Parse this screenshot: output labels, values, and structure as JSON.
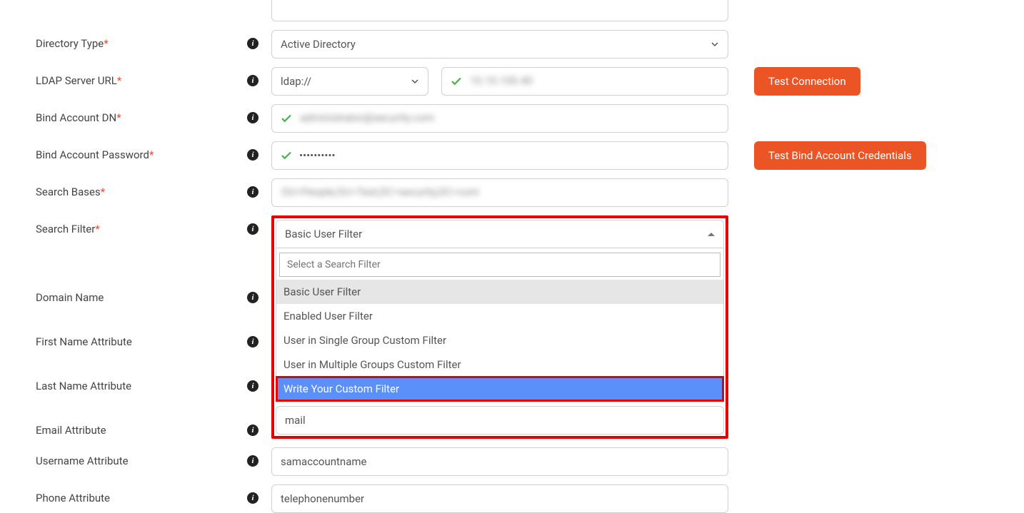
{
  "labels": {
    "directory_type": "Directory Type",
    "ldap_server_url": "LDAP Server URL",
    "bind_account_dn": "Bind Account DN",
    "bind_account_password": "Bind Account Password",
    "search_bases": "Search Bases",
    "search_filter": "Search Filter",
    "domain_name": "Domain Name",
    "first_name_attribute": "First Name Attribute",
    "last_name_attribute": "Last Name Attribute",
    "email_attribute": "Email Attribute",
    "username_attribute": "Username Attribute",
    "phone_attribute": "Phone Attribute"
  },
  "values": {
    "directory_type": "Active Directory",
    "ldap_protocol": "ldap://",
    "ldap_host_blurred": "10.10.100.40",
    "bind_dn_blurred": "administrator@security.com",
    "bind_password_masked": "••••••••••",
    "search_bases_blurred": "OU=People,OU=Test,DC=security,DC=com",
    "email_attribute": "mail",
    "username_attribute": "samaccountname",
    "phone_attribute": "telephonenumber"
  },
  "buttons": {
    "test_connection": "Test Connection",
    "test_bind": "Test Bind Account Credentials"
  },
  "search_filter_dropdown": {
    "selected": "Basic User Filter",
    "search_placeholder": "Select a Search Filter",
    "options": [
      "Basic User Filter",
      "Enabled User Filter",
      "User in Single Group Custom Filter",
      "User in Multiple Groups Custom Filter",
      "Write Your Custom Filter"
    ]
  },
  "info_glyph": "i"
}
